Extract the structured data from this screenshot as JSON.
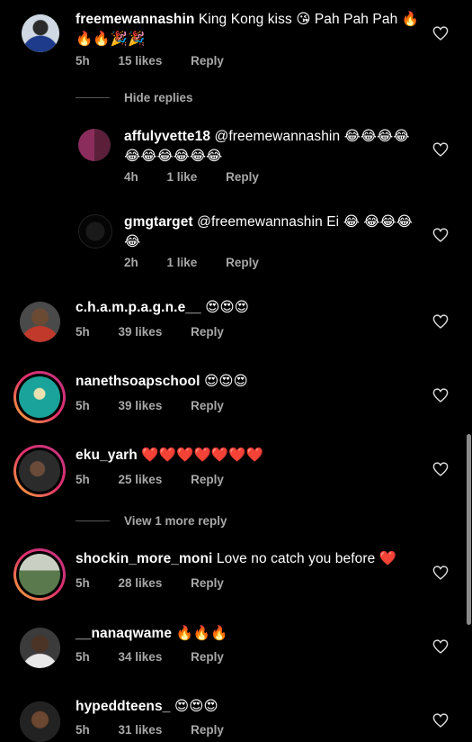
{
  "comments": [
    {
      "user": "freemewannashin",
      "text": "King Kong kiss 😘 Pah Pah Pah 🔥",
      "text2": "🔥🔥🎉🎉",
      "time": "5h",
      "likes": "15 likes",
      "reply": "Reply"
    },
    {
      "user": "affulyvette18",
      "text": "@freemewannashin 😂😂😂😂",
      "text2": "😂😂😂😂😂😂",
      "time": "4h",
      "likes": "1 like",
      "reply": "Reply"
    },
    {
      "user": "gmgtarget",
      "text": "@freemewannashin Ei 😂 😂😂😂",
      "text2": "😂",
      "time": "2h",
      "likes": "1 like",
      "reply": "Reply"
    },
    {
      "user": "c.h.a.m.p.a.g.n.e__",
      "text": "😍😍😍",
      "time": "5h",
      "likes": "39 likes",
      "reply": "Reply"
    },
    {
      "user": "nanethsoapschool",
      "text": "😍😍😍",
      "time": "5h",
      "likes": "39 likes",
      "reply": "Reply"
    },
    {
      "user": "eku_yarh",
      "text": "❤️❤️❤️❤️❤️❤️❤️",
      "time": "5h",
      "likes": "25 likes",
      "reply": "Reply"
    },
    {
      "user": "shockin_more_moni",
      "text": "Love no catch you before ❤️",
      "time": "5h",
      "likes": "28 likes",
      "reply": "Reply"
    },
    {
      "user": "__nanaqwame",
      "text": "🔥🔥🔥",
      "time": "5h",
      "likes": "34 likes",
      "reply": "Reply"
    },
    {
      "user": "hypeddteens_",
      "text": "😍😍😍",
      "time": "5h",
      "likes": "31 likes",
      "reply": "Reply"
    }
  ],
  "threads": {
    "hide_replies": "Hide replies",
    "view_more": "View 1 more reply"
  },
  "colors": {
    "background": "#000000",
    "secondary_text": "#a8a8a8",
    "heart_emoji": "#e0245e"
  }
}
